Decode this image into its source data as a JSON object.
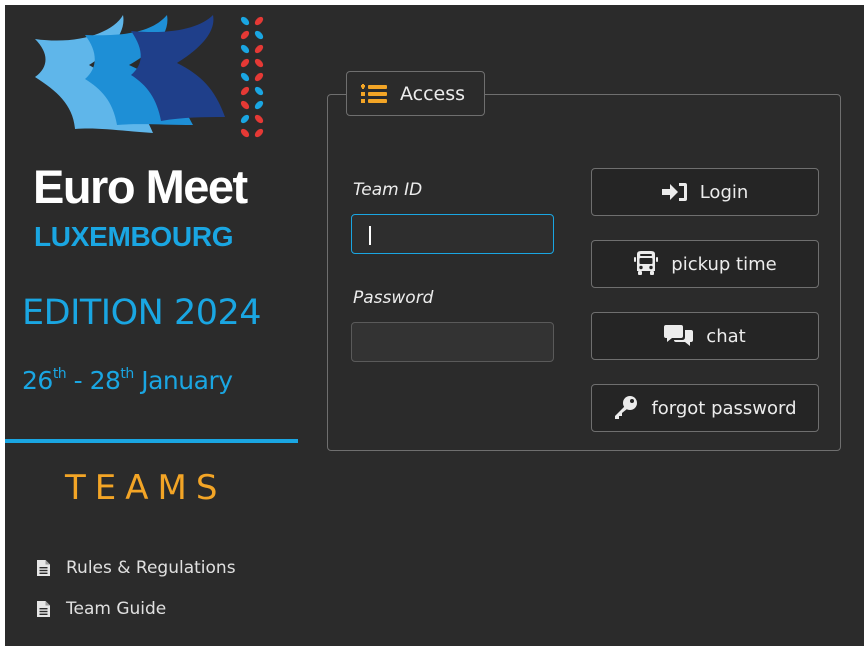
{
  "brand": {
    "title": "Euro Meet",
    "subtitle": "LUXEMBOURG",
    "edition": "EDITION 2024",
    "dates": {
      "start_day": "26",
      "start_suffix": "th",
      "separator": " - ",
      "end_day": "28",
      "end_suffix": "th",
      "month": " January"
    },
    "section": "TEAMS"
  },
  "sidebar": {
    "links": [
      {
        "label": "Rules & Regulations",
        "icon": "document-icon"
      },
      {
        "label": "Team Guide",
        "icon": "document-icon"
      }
    ]
  },
  "access": {
    "tab_label": "Access",
    "tab_icon": "list-icon",
    "team_id_label": "Team ID",
    "team_id_value": "",
    "password_label": "Password",
    "password_value": "",
    "buttons": [
      {
        "label": "Login",
        "icon": "sign-in-icon"
      },
      {
        "label": "pickup time",
        "icon": "bus-icon"
      },
      {
        "label": "chat",
        "icon": "chat-icon"
      },
      {
        "label": "forgot password",
        "icon": "key-icon"
      }
    ]
  },
  "colors": {
    "background": "#2b2b2b",
    "accent_blue": "#1aa6e2",
    "accent_orange": "#f3a526",
    "logo_red": "#e53935",
    "logo_light_blue": "#5fb6ea",
    "logo_mid_blue": "#1e8fd6",
    "logo_dark_blue": "#1f3f8a",
    "text": "#ececec"
  }
}
